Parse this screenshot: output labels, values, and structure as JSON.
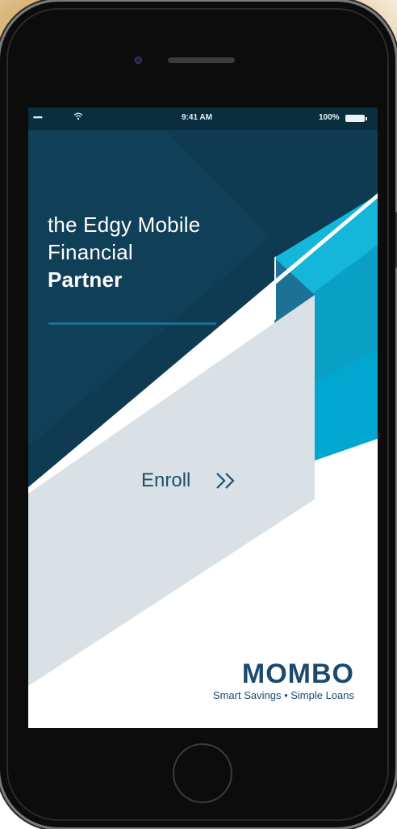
{
  "status_bar": {
    "signal": "•••••",
    "time": "9:41 AM",
    "battery": "100%"
  },
  "hero": {
    "line1": "the Edgy Mobile",
    "line2": "Financial",
    "line3": "Partner"
  },
  "enroll": {
    "label": "Enroll",
    "icon": "double-chevron-right-icon"
  },
  "brand": {
    "name": "MOMBO",
    "tagline": "Smart Savings • Simple Loans"
  },
  "colors": {
    "navy": "#0e3b52",
    "teal": "#00a8cf",
    "pale_gray": "#d9e1e6",
    "brand_blue": "#1c4a6e"
  }
}
